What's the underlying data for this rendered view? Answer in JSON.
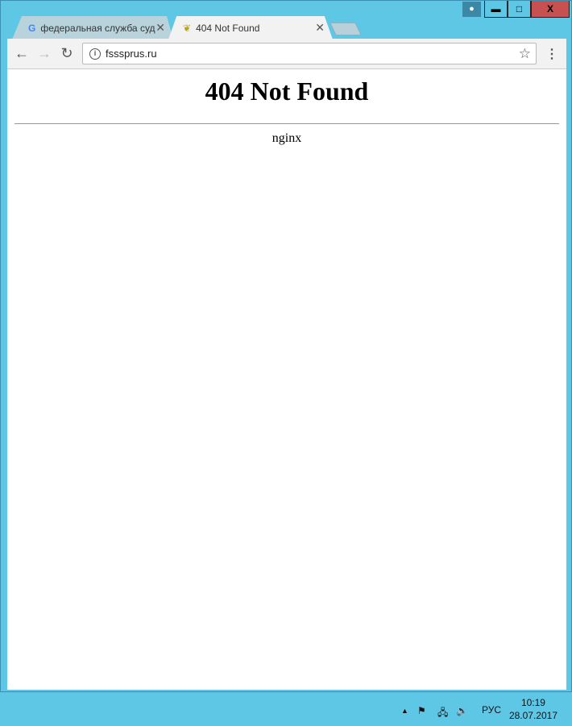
{
  "window": {
    "user_icon": "user-icon",
    "minimize": "▬",
    "maximize": "☐",
    "close": "X"
  },
  "tabs": [
    {
      "title": "федеральная служба судебных приставов",
      "icon": "google-icon"
    },
    {
      "title": "404 Not Found",
      "icon": "fssp-emblem-icon",
      "active": true
    }
  ],
  "toolbar": {
    "url": "fsssprus.ru",
    "back": "←",
    "forward": "→",
    "reload": "C",
    "star": "☆",
    "menu": "⋮"
  },
  "page": {
    "heading": "404 Not Found",
    "server": "nginx"
  },
  "taskbar": {
    "language": "РУС",
    "time": "10:19",
    "date": "28.07.2017"
  }
}
